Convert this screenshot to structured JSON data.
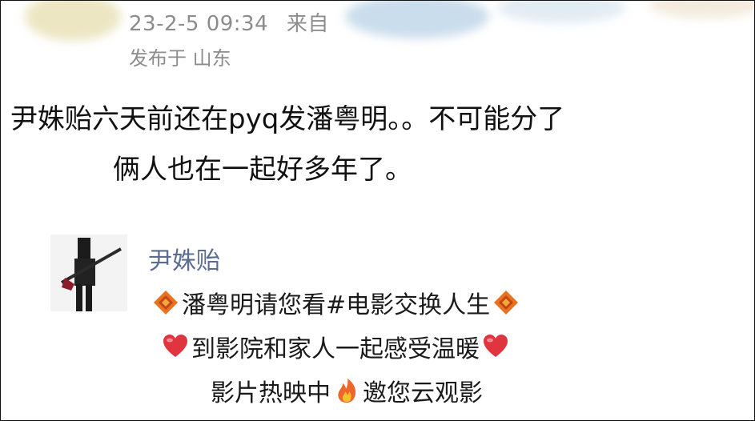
{
  "meta": {
    "timestamp": "23-2-5 09:34",
    "source_prefix": "来自",
    "location": "发布于 山东"
  },
  "post": {
    "line1": "尹姝贻六天前还在pyq发潘粤明。。不可能分了",
    "line2": "俩人也在一起好多年了。"
  },
  "shared": {
    "name": "尹姝贻",
    "line1": "潘粤明请您看#电影交换人生",
    "line2": "到影院和家人一起感受温暖",
    "line3_a": "影片热映中",
    "line3_b": "邀您云观影"
  },
  "icons": [
    "diamond-icon",
    "heart-icon",
    "fire-icon"
  ],
  "colors": {
    "meta_text": "#8c8c8c",
    "name_text": "#5b6b92",
    "heart": "#e0353f",
    "diamond": "#e8731f"
  }
}
